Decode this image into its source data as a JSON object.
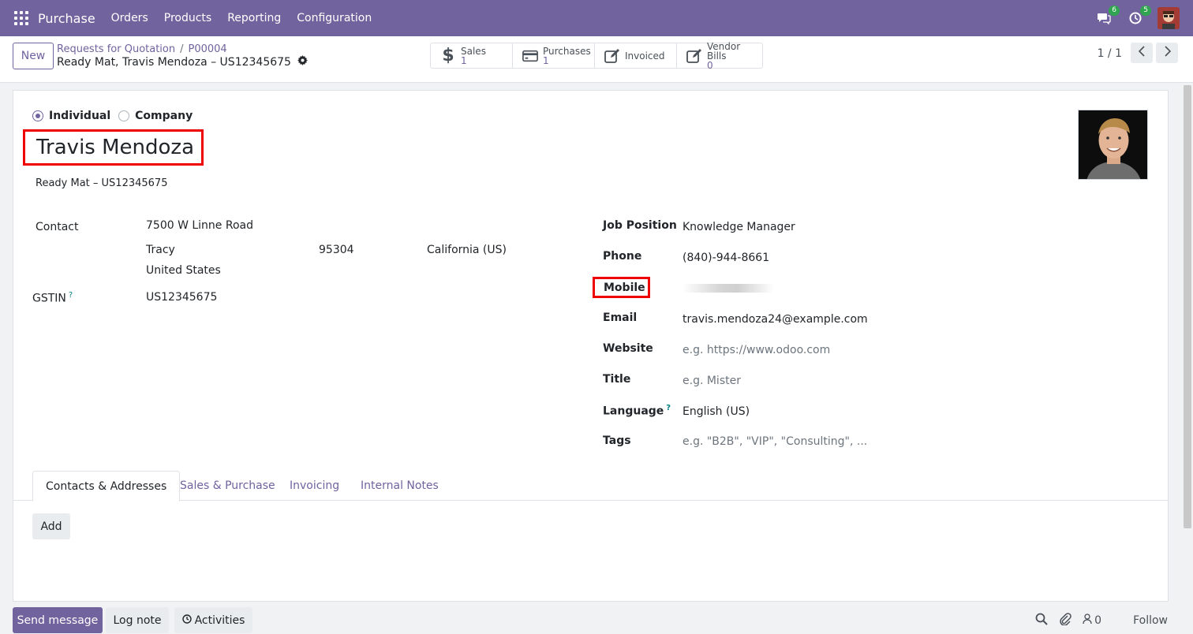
{
  "navbar": {
    "brand": "Purchase",
    "menu": [
      "Orders",
      "Products",
      "Reporting",
      "Configuration"
    ],
    "messages_count": "6",
    "activities_count": "5"
  },
  "control": {
    "new_label": "New",
    "breadcrumb_root": "Requests for Quotation",
    "breadcrumb_sep": "/",
    "breadcrumb_parent": "P00004",
    "record_title": "Ready Mat, Travis Mendoza – US12345675",
    "smart_buttons": [
      {
        "label": "Sales",
        "count": "1",
        "icon": "dollar-icon"
      },
      {
        "label": "Purchases",
        "count": "1",
        "icon": "credit-card-icon"
      },
      {
        "label": "Invoiced",
        "count": "",
        "icon": "pencil-square-icon"
      },
      {
        "label": "Vendor Bills",
        "count": "0",
        "icon": "pencil-square-icon"
      }
    ],
    "pager": "1 / 1"
  },
  "form": {
    "type_individual": "Individual",
    "type_company": "Company",
    "name": "Travis Mendoza",
    "company_line": "Ready Mat – US12345675",
    "contact_label": "Contact",
    "street": "7500 W Linne Road",
    "city": "Tracy",
    "zip": "95304",
    "state": "California (US)",
    "country": "United States",
    "gstin_label": "GSTIN",
    "gstin_help": "?",
    "gstin": "US12345675",
    "job_position_label": "Job Position",
    "job_position": "Knowledge Manager",
    "phone_label": "Phone",
    "phone": "(840)-944-8661",
    "mobile_label": "Mobile",
    "email_label": "Email",
    "email": "travis.mendoza24@example.com",
    "website_label": "Website",
    "website_placeholder": "e.g. https://www.odoo.com",
    "title_label": "Title",
    "title_placeholder": "e.g. Mister",
    "language_label": "Language",
    "language_help": "?",
    "language": "English (US)",
    "tags_label": "Tags",
    "tags_placeholder": "e.g. \"B2B\", \"VIP\", \"Consulting\", ..."
  },
  "tabs": [
    "Contacts & Addresses",
    "Sales & Purchase",
    "Invoicing",
    "Internal Notes"
  ],
  "add_label": "Add",
  "chatter": {
    "send_message": "Send message",
    "log_note": "Log note",
    "activities": "Activities",
    "followers_count": "0",
    "follow": "Follow"
  },
  "colors": {
    "brand": "#71639e",
    "highlight": "#ee0000",
    "badge": "#2ea54e"
  }
}
